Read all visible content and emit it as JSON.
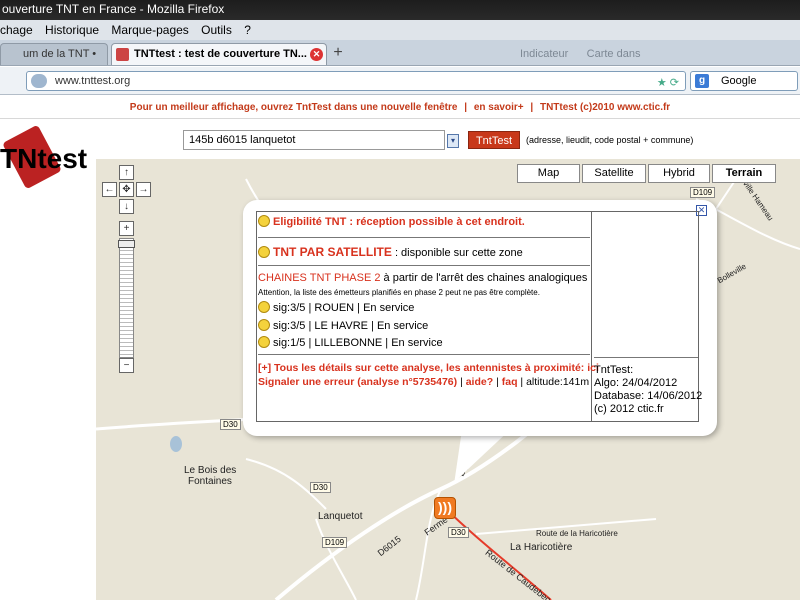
{
  "window": {
    "title": "ouverture TNT en France - Mozilla Firefox"
  },
  "menubar": {
    "items": [
      "chage",
      "Historique",
      "Marque-pages",
      "Outils",
      "?"
    ]
  },
  "tabs": [
    {
      "label": "um de la TNT • G...",
      "active": false
    },
    {
      "label": "TNTtest : test de couverture TN...",
      "active": true
    }
  ],
  "faded_tabs": [
    "Indicateur",
    "Carte dans"
  ],
  "address": {
    "url": "www.tnttest.org"
  },
  "search_engine": {
    "label": "Google"
  },
  "infobar": {
    "items": [
      "Pour un meilleur affichage, ouvrez TntTest dans une nouvelle fenêtre",
      "|",
      "en savoir+",
      "|",
      "TNTtest (c)2010 www.ctic.fr"
    ]
  },
  "logo": {
    "text": "TNtest"
  },
  "search": {
    "value": "145b d6015 lanquetot",
    "button": "TntTest",
    "hint": "(adresse, lieudit, code postal + commune)"
  },
  "map_types": [
    "Map",
    "Satellite",
    "Hybrid",
    "Terrain"
  ],
  "map_type_selected": "Terrain",
  "zoom_controls": {
    "up": "↑",
    "left": "←",
    "center": "✥",
    "right": "→",
    "down": "↓",
    "plus": "+",
    "minus": "−"
  },
  "popup": {
    "eligibility": "Eligibilité TNT : réception possible à cet endroit.",
    "satellite_title": "TNT PAR SATELLITE",
    "satellite_text": " : disponible sur cette zone",
    "phase_title": "CHAINES TNT PHASE 2",
    "phase_text": " à partir de l'arrêt des chaines analogiques",
    "phase_note": "Attention, la liste des émetteurs planifiés en phase 2 peut ne pas être complète.",
    "transmitters": [
      "sig:3/5 | ROUEN | En service",
      "sig:3/5 | LE HAVRE | En service",
      "sig:1/5 | LILLEBONNE | En service"
    ],
    "details_link": "[+] Tous les détails sur cette analyse, les antennistes à proximité: ici",
    "error_link": "Signaler une erreur (analyse n°5735476)",
    "help_link": "aide?",
    "faq_link": "faq",
    "altitude": "altitude:141m",
    "meta": {
      "app": "TntTest:",
      "algo": "Algo: 24/04/2012",
      "database": "Database: 14/06/2012",
      "copyright": "(c) 2012 ctic.fr"
    }
  },
  "map_labels": {
    "bois": "Le Bois des",
    "fontaines": "Fontaines",
    "lanquetot": "Lanquetot",
    "haricotiere_route": "Route de la Haricotière",
    "haricotiere": "La Haricotière",
    "caudebec": "Route de Caudebec",
    "ferme": "Ferme",
    "bolleville": "Bolleville",
    "bolleville_hameau": "Bolleville Hameau"
  },
  "road_tags": [
    "D109",
    "D30",
    "D30",
    "D109",
    "D30",
    "D6015",
    "D6015"
  ],
  "colors": {
    "accent": "#c8381a",
    "map_bg": "#e8e4d6",
    "road_red": "#e53b2a"
  }
}
